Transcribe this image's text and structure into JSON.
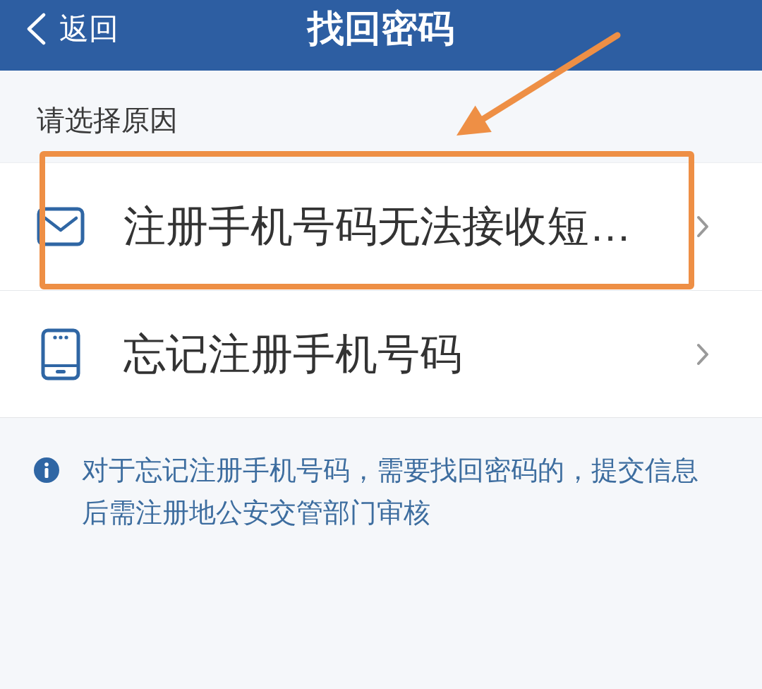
{
  "header": {
    "back_label": "返回",
    "title": "找回密码"
  },
  "section_label": "请选择原因",
  "options": [
    {
      "kind": "sms",
      "label": "注册手机号码无法接收短…",
      "highlighted": true
    },
    {
      "kind": "phone",
      "label": "忘记注册手机号码",
      "highlighted": false
    }
  ],
  "notice": {
    "text": "对于忘记注册手机号码，需要找回密码的，提交信息后需注册地公安交管部门审核"
  }
}
